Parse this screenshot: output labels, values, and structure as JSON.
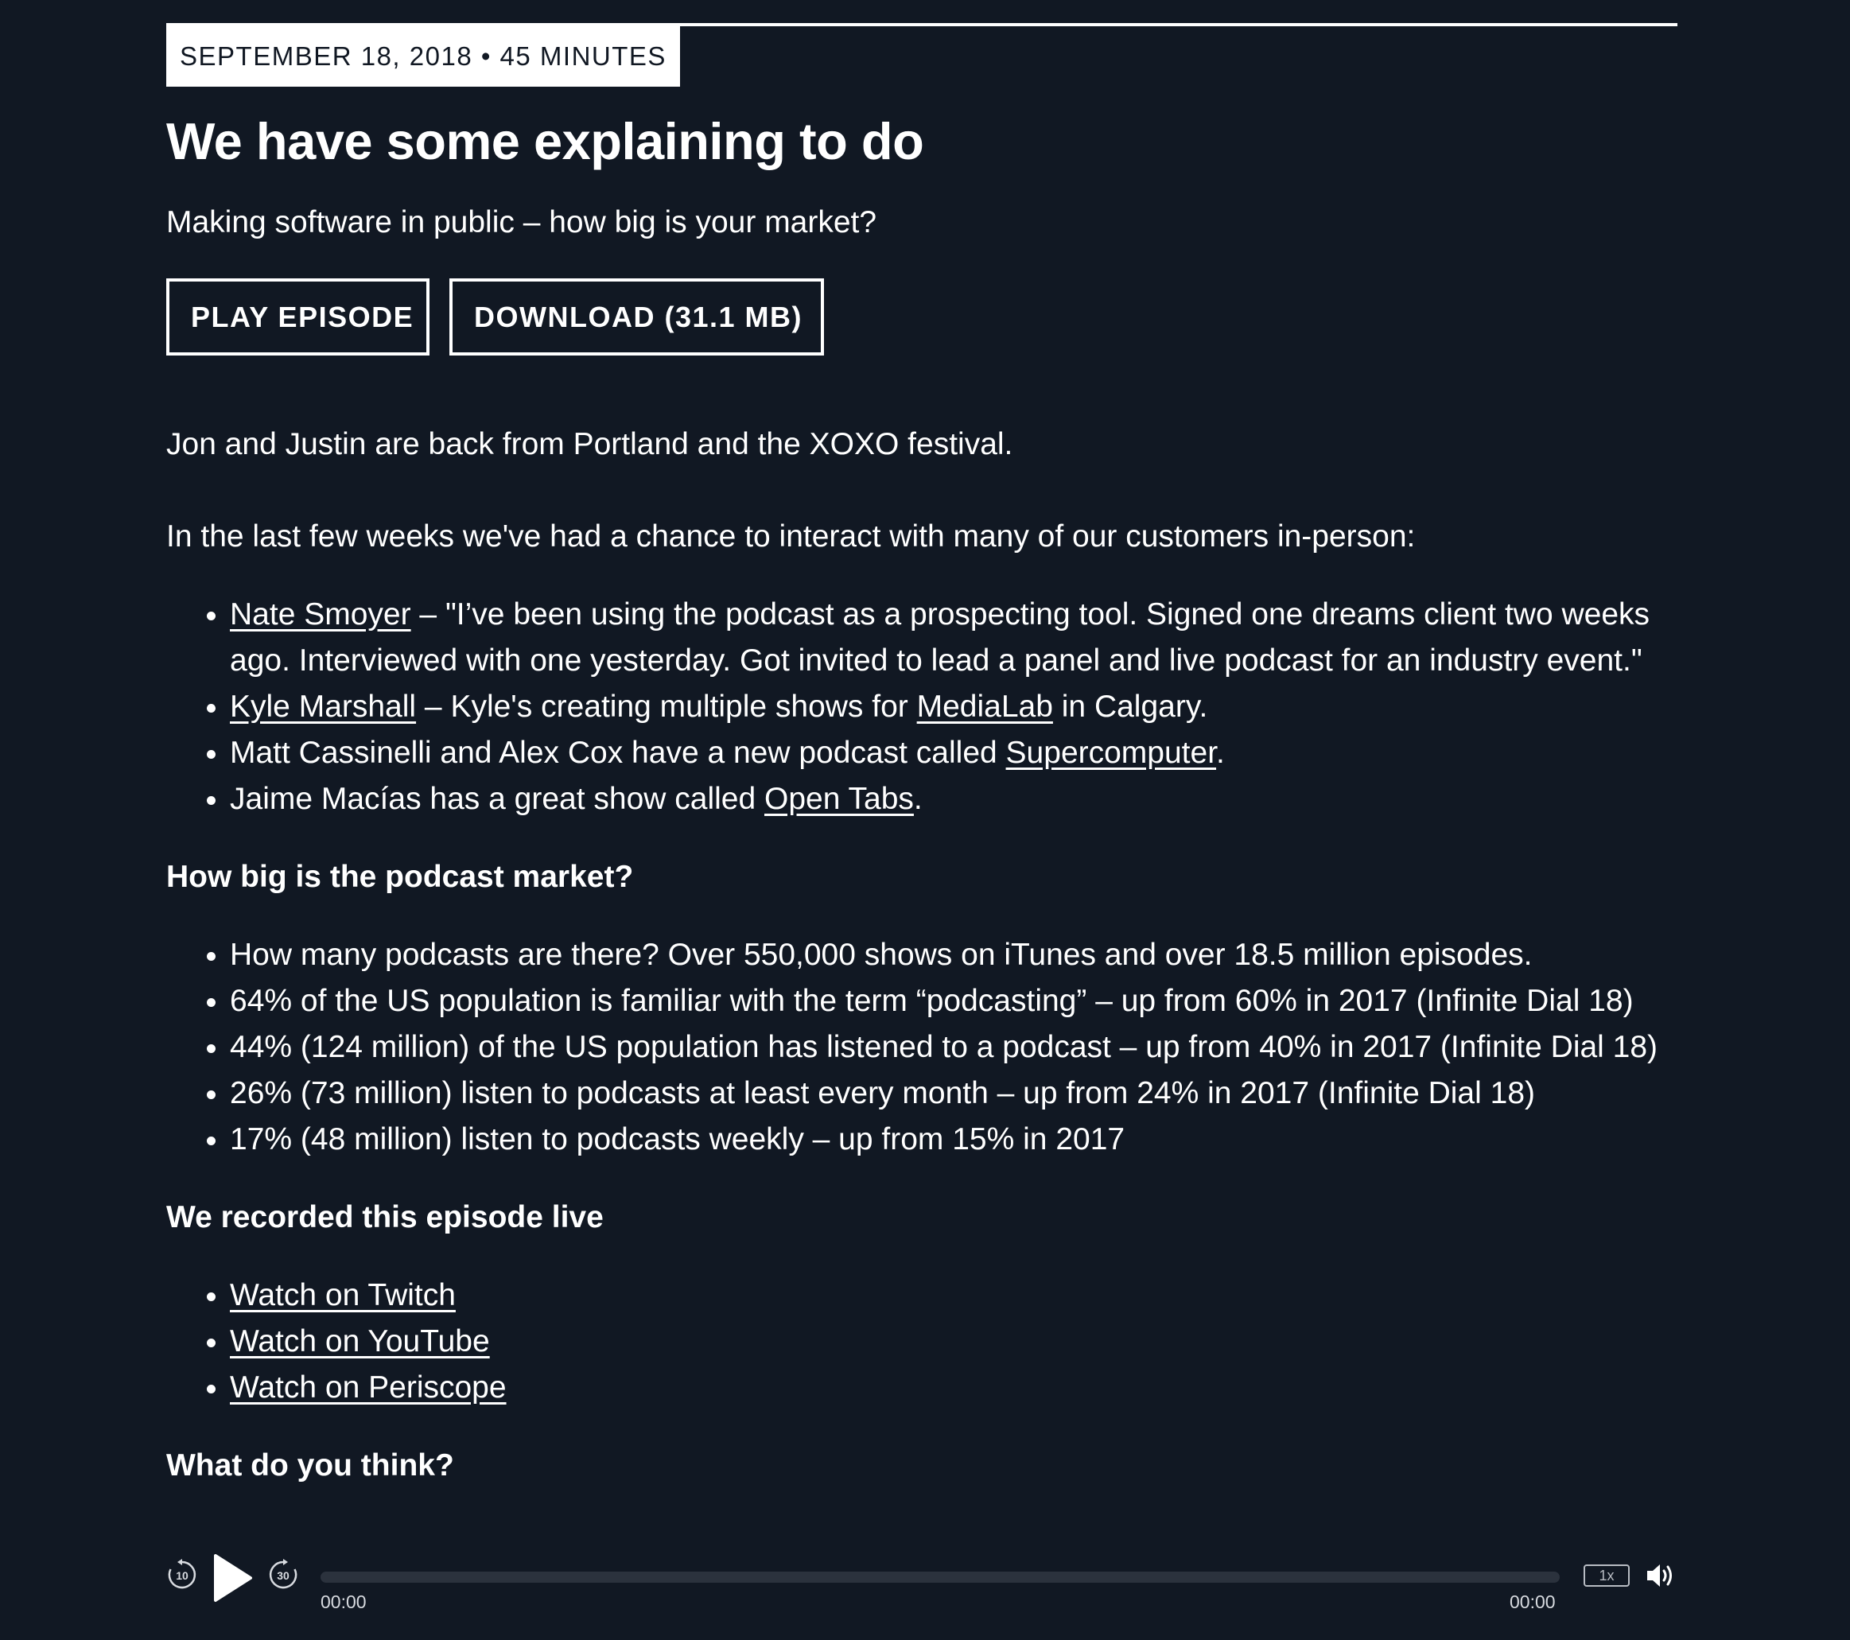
{
  "episode": {
    "meta": "SEPTEMBER 18, 2018 • 45 MINUTES",
    "title": "We have some explaining to do",
    "subtitle": "Making software in public – how big is your market?",
    "play_label": "PLAY EPISODE",
    "download_label": "DOWNLOAD (31.1 MB)"
  },
  "content": {
    "intro": "Jon and Justin are back from Portland and the XOXO festival.",
    "customers_lead": "In the last few weeks we've had a chance to interact with many of our customers in-person:",
    "customers": [
      {
        "link": "Nate Smoyer",
        "text": " – \"I’ve been using the podcast as a prospecting tool. Signed one dreams client two weeks ago. Interviewed with one yesterday. Got invited to lead a panel and live podcast for an industry event.\""
      },
      {
        "link": "Kyle Marshall",
        "text": " – Kyle's creating multiple shows for ",
        "link2": "MediaLab",
        "text2": " in Calgary."
      },
      {
        "text": "Matt Cassinelli and Alex Cox have a new podcast called ",
        "link": "Supercomputer",
        "text2": "."
      },
      {
        "text": "Jaime Macías has a great show called ",
        "link": "Open Tabs",
        "text2": "."
      }
    ],
    "market_heading": "How big is the podcast market?",
    "market_stats": [
      "How many podcasts are there? Over 550,000 shows on iTunes and over 18.5 million episodes.",
      "64% of the US population is familiar with the term “podcasting” – up from 60% in 2017 (Infinite Dial 18)",
      "44% (124 million) of the US population has listened to a podcast – up from 40% in 2017 (Infinite Dial 18)",
      "26% (73 million) listen to podcasts at least every month – up from 24% in 2017 (Infinite Dial 18)",
      "17% (48 million) listen to podcasts weekly – up from 15% in 2017"
    ],
    "live_heading": "We recorded this episode live",
    "live_links": [
      "Watch on Twitch",
      "Watch on YouTube",
      "Watch on Periscope"
    ],
    "feedback_heading": "What do you think?"
  },
  "player": {
    "current_time": "00:00",
    "total_time": "00:00",
    "speed": "1x",
    "skip_back_seconds": "10",
    "skip_forward_seconds": "30",
    "progress": 0,
    "icons": [
      "skip-back-10-icon",
      "play-icon",
      "skip-forward-30-icon",
      "volume-icon"
    ]
  }
}
